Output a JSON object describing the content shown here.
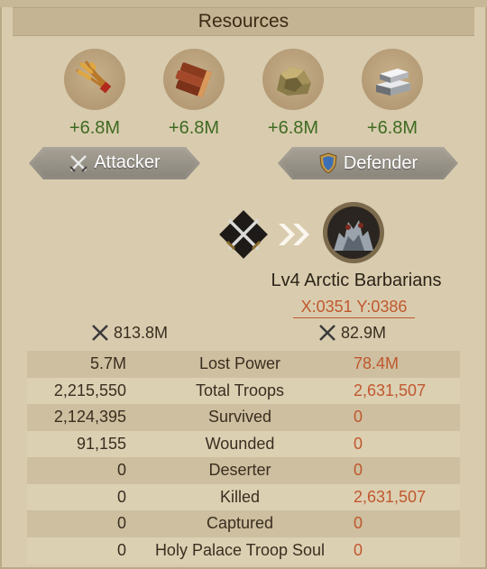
{
  "header": {
    "title": "Resources"
  },
  "resources": [
    {
      "name": "food-icon",
      "amount": "+6.8M"
    },
    {
      "name": "wood-icon",
      "amount": "+6.8M"
    },
    {
      "name": "stone-icon",
      "amount": "+6.8M"
    },
    {
      "name": "iron-icon",
      "amount": "+6.8M"
    }
  ],
  "roles": {
    "attacker": "Attacker",
    "defender": "Defender"
  },
  "enemy": {
    "name": "Lv4 Arctic Barbarians",
    "coords": "X:0351 Y:0386"
  },
  "power": {
    "attacker": "813.8M",
    "defender": "82.9M"
  },
  "stats": [
    {
      "left": "5.7M",
      "label": "Lost Power",
      "right": "78.4M"
    },
    {
      "left": "2,215,550",
      "label": "Total Troops",
      "right": "2,631,507"
    },
    {
      "left": "2,124,395",
      "label": "Survived",
      "right": "0"
    },
    {
      "left": "91,155",
      "label": "Wounded",
      "right": "0"
    },
    {
      "left": "0",
      "label": "Deserter",
      "right": "0"
    },
    {
      "left": "0",
      "label": "Killed",
      "right": "2,631,507"
    },
    {
      "left": "0",
      "label": "Captured",
      "right": "0"
    },
    {
      "left": "0",
      "label": "Holy Palace Troop Soul",
      "right": "0"
    }
  ],
  "colors": {
    "gain": "#3f6a22",
    "enemy_value": "#c0582e",
    "panel": "#d9ccae"
  }
}
